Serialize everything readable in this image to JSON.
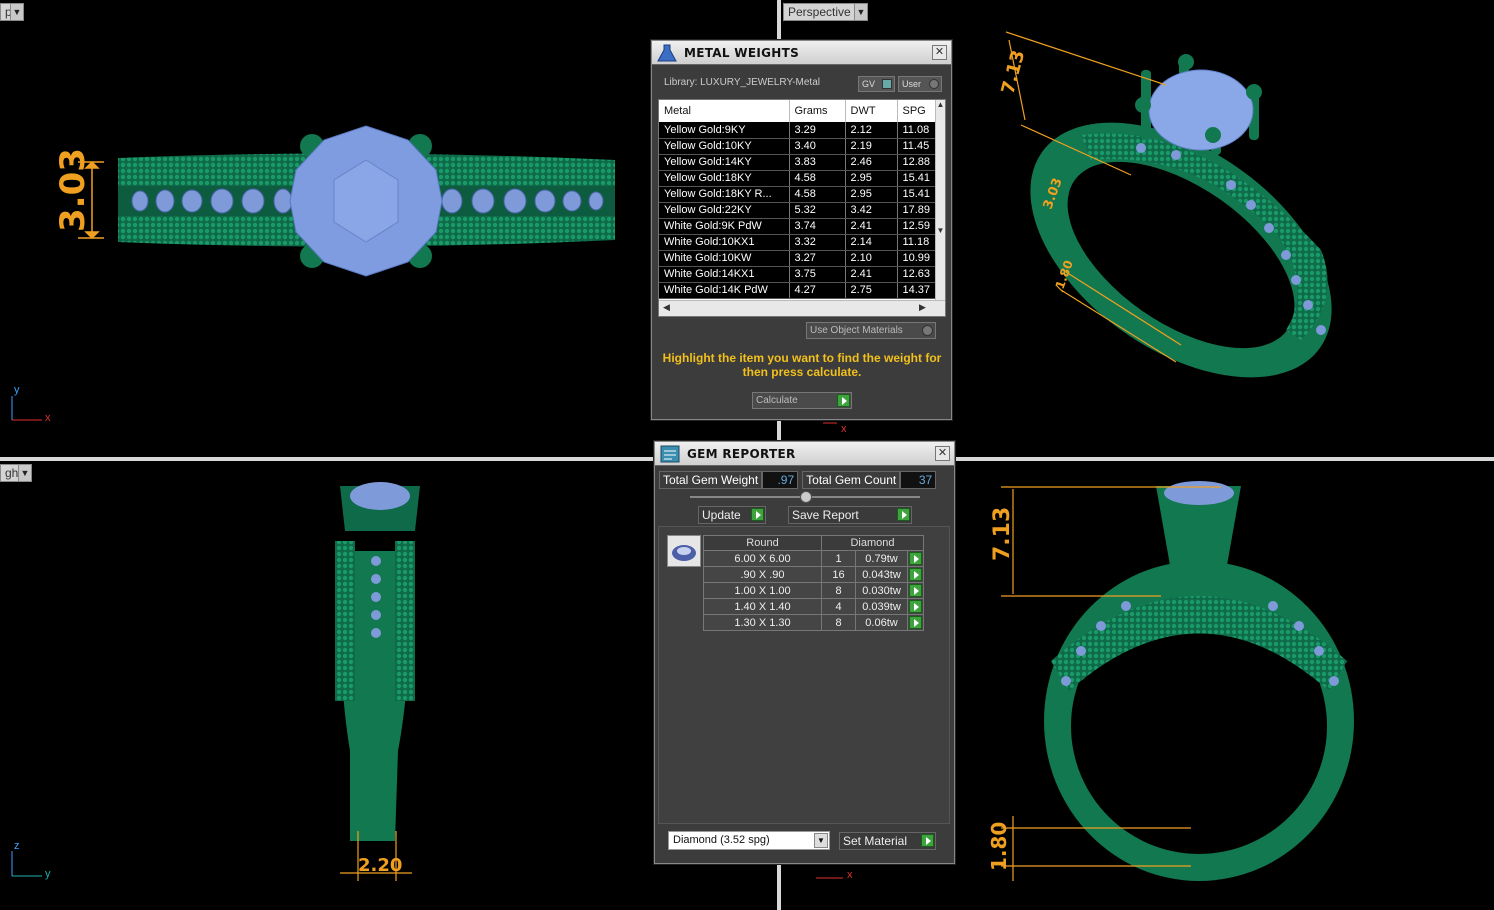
{
  "viewports": {
    "top_left_label": "p",
    "perspective_label": "Perspective",
    "bottom_left_label": "ght"
  },
  "dimensions": {
    "top_height": "3.03",
    "persp_height": "7.13",
    "persp_mid": "3.03",
    "persp_low": "1.80",
    "right_width": "2.20",
    "front_height": "7.13",
    "front_shank": "1.80"
  },
  "axes": {
    "top_y": "y",
    "top_x": "x",
    "persp_x": "x",
    "right_z": "z",
    "right_y": "y",
    "front_x": "x"
  },
  "metal_weights": {
    "title": "METAL WEIGHTS",
    "library": "Library: LUXURY_JEWELRY-Metal",
    "toggle_gv": "GV",
    "toggle_user": "User",
    "columns": [
      "Metal",
      "Grams",
      "DWT",
      "SPG"
    ],
    "rows": [
      [
        "Yellow Gold:9KY",
        "3.29",
        "2.12",
        "11.08"
      ],
      [
        "Yellow Gold:10KY",
        "3.40",
        "2.19",
        "11.45"
      ],
      [
        "Yellow Gold:14KY",
        "3.83",
        "2.46",
        "12.88"
      ],
      [
        "Yellow Gold:18KY",
        "4.58",
        "2.95",
        "15.41"
      ],
      [
        "Yellow Gold:18KY R...",
        "4.58",
        "2.95",
        "15.41"
      ],
      [
        "Yellow Gold:22KY",
        "5.32",
        "3.42",
        "17.89"
      ],
      [
        "White Gold:9K PdW",
        "3.74",
        "2.41",
        "12.59"
      ],
      [
        "White Gold:10KX1",
        "3.32",
        "2.14",
        "11.18"
      ],
      [
        "White Gold:10KW",
        "3.27",
        "2.10",
        "10.99"
      ],
      [
        "White Gold:14KX1",
        "3.75",
        "2.41",
        "12.63"
      ],
      [
        "White Gold:14K PdW",
        "4.27",
        "2.75",
        "14.37"
      ]
    ],
    "use_object_materials": "Use Object Materials",
    "hint": "Highlight the item you want to find the weight for then press calculate.",
    "calculate": "Calculate"
  },
  "gem_reporter": {
    "title": "GEM REPORTER",
    "total_weight_label": "Total Gem Weight",
    "total_weight_value": ".97",
    "total_count_label": "Total Gem Count",
    "total_count_value": "37",
    "update": "Update",
    "save_report": "Save Report",
    "shape_header": "Round",
    "material_header": "Diamond",
    "rows": [
      [
        "6.00 X 6.00",
        "1",
        "0.79tw"
      ],
      [
        ".90 X .90",
        "16",
        "0.043tw"
      ],
      [
        "1.00 X 1.00",
        "8",
        "0.030tw"
      ],
      [
        "1.40 X 1.40",
        "4",
        "0.039tw"
      ],
      [
        "1.30 X 1.30",
        "8",
        "0.06tw"
      ]
    ],
    "material_select": "Diamond    (3.52 spg)",
    "set_material": "Set Material"
  },
  "colors": {
    "metal": "#117a55",
    "gem": "#7e9ad8",
    "dimension": "#f0a020",
    "hint": "#f2c01c"
  }
}
